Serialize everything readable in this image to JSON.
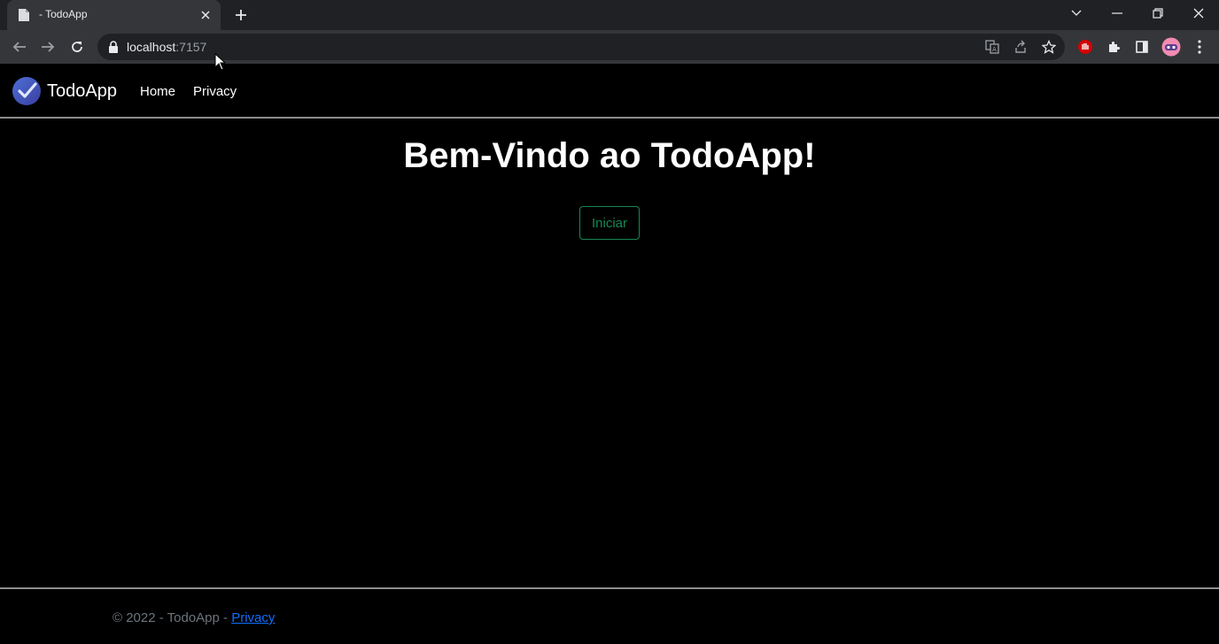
{
  "tab": {
    "title": "- TodoApp"
  },
  "address": {
    "host": "localhost",
    "port": ":7157"
  },
  "navbar": {
    "brand": "TodoApp",
    "links": [
      "Home",
      "Privacy"
    ]
  },
  "main": {
    "title": "Bem-Vindo ao TodoApp!",
    "start_button": "Iniciar"
  },
  "footer": {
    "text": "© 2022 - TodoApp - ",
    "link": "Privacy"
  },
  "colors": {
    "page_bg": "#000000",
    "success": "#198754",
    "link": "#0d6efd",
    "muted": "#6c757d"
  }
}
